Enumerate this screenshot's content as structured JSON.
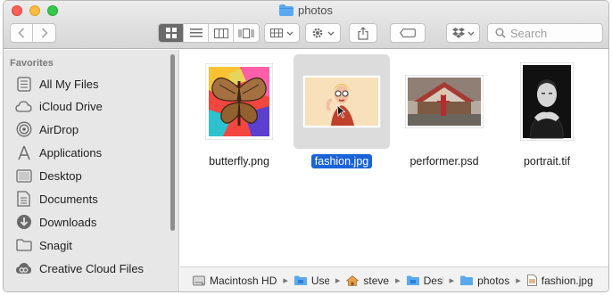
{
  "window": {
    "title": "photos"
  },
  "toolbar": {
    "back_icon": "chevron-left-icon",
    "forward_icon": "chevron-right-icon",
    "view_modes": [
      "icon-view",
      "list-view",
      "column-view",
      "cover-flow-view"
    ],
    "active_view": "icon-view",
    "search_placeholder": "Search"
  },
  "sidebar": {
    "heading": "Favorites",
    "items": [
      {
        "label": "All My Files",
        "icon": "all-files-icon"
      },
      {
        "label": "iCloud Drive",
        "icon": "cloud-icon"
      },
      {
        "label": "AirDrop",
        "icon": "airdrop-icon"
      },
      {
        "label": "Applications",
        "icon": "applications-icon"
      },
      {
        "label": "Desktop",
        "icon": "desktop-icon"
      },
      {
        "label": "Documents",
        "icon": "documents-icon"
      },
      {
        "label": "Downloads",
        "icon": "downloads-icon"
      },
      {
        "label": "Snagit",
        "icon": "folder-icon"
      },
      {
        "label": "Creative Cloud Files",
        "icon": "creative-cloud-icon"
      }
    ]
  },
  "files": [
    {
      "name": "butterfly.png",
      "selected": false
    },
    {
      "name": "fashion.jpg",
      "selected": true
    },
    {
      "name": "performer.psd",
      "selected": false
    },
    {
      "name": "portrait.tif",
      "selected": false
    }
  ],
  "pathbar": {
    "items": [
      {
        "label": "Macintosh HD",
        "icon": "hard-drive-icon"
      },
      {
        "label": "Users",
        "icon": "folder-icon"
      },
      {
        "label": "steve",
        "icon": "home-icon"
      },
      {
        "label": "Desktop",
        "icon": "folder-icon"
      },
      {
        "label": "photos",
        "icon": "folder-icon"
      },
      {
        "label": "fashion.jpg",
        "icon": "file-icon"
      }
    ]
  },
  "colors": {
    "selection": "#1a63d8",
    "folder": "#5aa9f0"
  }
}
